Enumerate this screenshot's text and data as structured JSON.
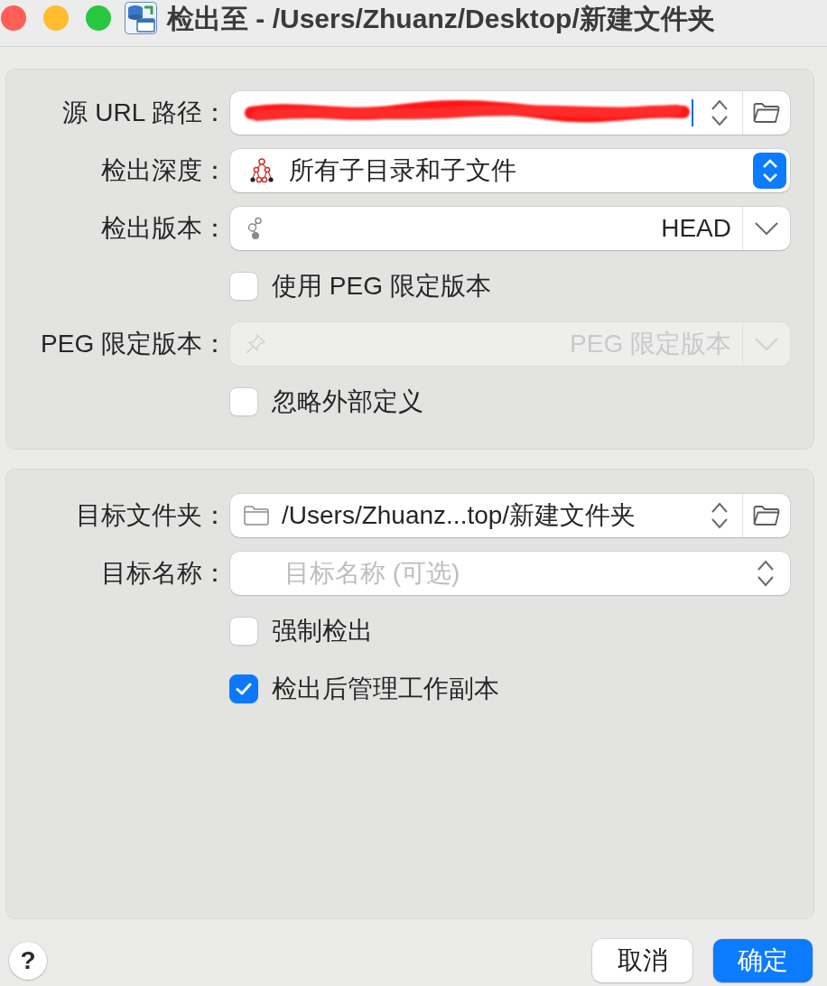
{
  "window": {
    "title": "检出至 - /Users/Zhuanz/Desktop/新建文件夹"
  },
  "source_section": {
    "rows": [
      {
        "kind": "source",
        "label": "源 URL 路径：",
        "redacted": true,
        "focused": true
      },
      {
        "kind": "depth",
        "label": "检出深度：",
        "value": "所有子目录和子文件"
      },
      {
        "kind": "revision",
        "label": "检出版本：",
        "value": "HEAD",
        "disabled": false
      },
      {
        "kind": "checkbox",
        "label": "使用 PEG 限定版本",
        "checked": false
      },
      {
        "kind": "peg",
        "label": "PEG 限定版本：",
        "placeholder": "PEG 限定版本",
        "disabled": true
      },
      {
        "kind": "checkbox",
        "label": "忽略外部定义",
        "checked": false
      }
    ]
  },
  "target_section": {
    "rows": [
      {
        "kind": "folder",
        "label": "目标文件夹：",
        "value": "/Users/Zhuanz...top/新建文件夹"
      },
      {
        "kind": "name",
        "label": "目标名称：",
        "placeholder": "目标名称 (可选)"
      },
      {
        "kind": "checkbox",
        "label": "强制检出",
        "checked": false
      },
      {
        "kind": "checkbox",
        "label": "检出后管理工作副本",
        "checked": true
      }
    ]
  },
  "footer": {
    "help": "?",
    "buttons": [
      {
        "label": "取消",
        "primary": false
      },
      {
        "label": "确定",
        "primary": true
      }
    ]
  }
}
